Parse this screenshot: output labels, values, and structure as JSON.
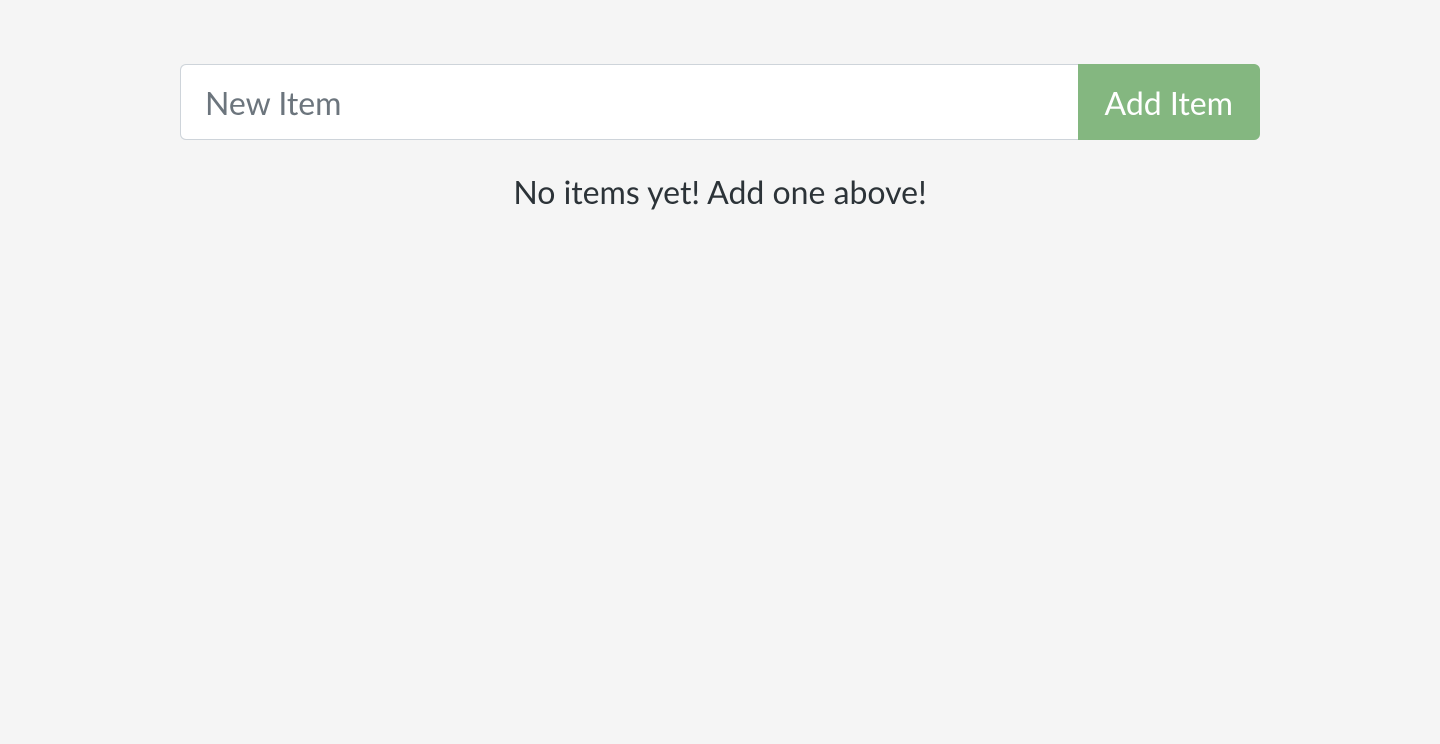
{
  "form": {
    "new_item_placeholder": "New Item",
    "add_button_label": "Add Item"
  },
  "list": {
    "empty_message": "No items yet! Add one above!"
  }
}
